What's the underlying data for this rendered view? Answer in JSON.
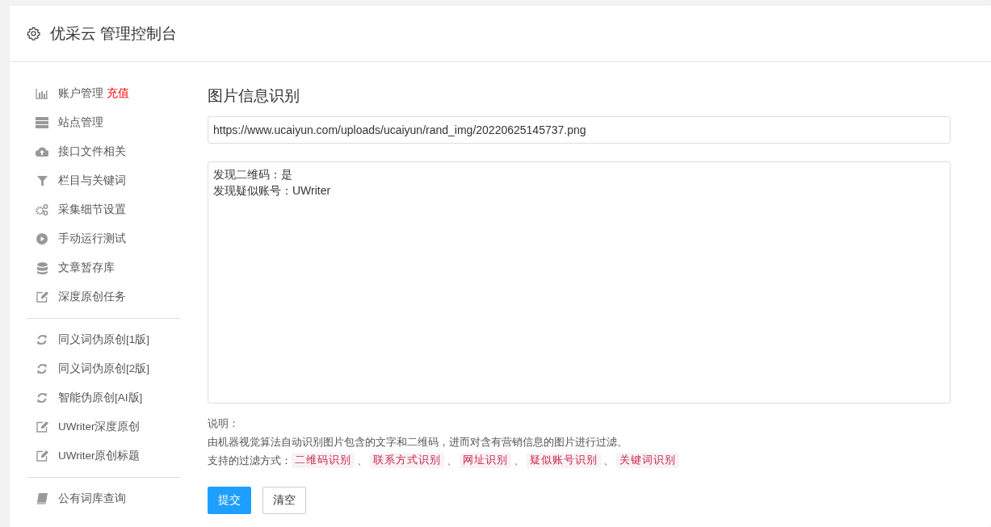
{
  "header": {
    "title": "优采云 管理控制台"
  },
  "sidebar": {
    "groups": [
      {
        "items": [
          {
            "label": "账户管理",
            "badge": "充值"
          },
          {
            "label": "站点管理"
          },
          {
            "label": "接口文件相关"
          },
          {
            "label": "栏目与关键词"
          },
          {
            "label": "采集细节设置"
          },
          {
            "label": "手动运行测试"
          },
          {
            "label": "文章暂存库"
          },
          {
            "label": "深度原创任务"
          }
        ]
      },
      {
        "items": [
          {
            "label": "同义词伪原创[1版]"
          },
          {
            "label": "同义词伪原创[2版]"
          },
          {
            "label": "智能伪原创[AI版]"
          },
          {
            "label": "UWriter深度原创"
          },
          {
            "label": "UWriter原创标题"
          }
        ]
      },
      {
        "items": [
          {
            "label": "公有词库查询"
          }
        ]
      }
    ]
  },
  "main": {
    "heading": "图片信息识别",
    "url_field": {
      "value": "https://www.ucaiyun.com/uploads/ucaiyun/rand_img/20220625145737.png"
    },
    "result_field": {
      "lines": [
        "发现二维码：是",
        "发现疑似账号：UWriter"
      ]
    },
    "notes": {
      "title": "说明：",
      "description": "由机器视觉算法自动识别图片包含的文字和二维码，进而对含有营销信息的图片进行过滤。",
      "filters_label": "支持的过滤方式：",
      "separator": "、",
      "filters": [
        "二维码识别",
        "联系方式识别",
        "网址识别",
        "疑似账号识别",
        "关键词识别"
      ]
    },
    "buttons": [
      {
        "label": "提交",
        "kind": "primary"
      },
      {
        "label": "清空",
        "kind": "default"
      }
    ]
  }
}
